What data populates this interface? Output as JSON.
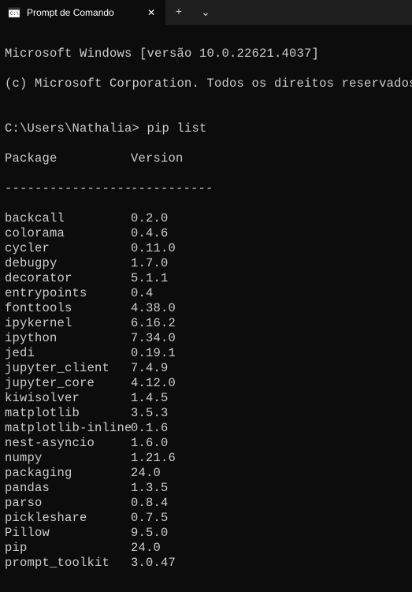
{
  "titlebar": {
    "tab_title": "Prompt de Comando",
    "close_glyph": "✕",
    "new_tab_glyph": "+",
    "dropdown_glyph": "⌄"
  },
  "terminal": {
    "line1": "Microsoft Windows [versão 10.0.22621.4037]",
    "line2": "(c) Microsoft Corporation. Todos os direitos reservados.",
    "blank": "",
    "prompt": "C:\\Users\\Nathalia> ",
    "command": "pip list",
    "header_pkg": "Package",
    "header_ver": "Version",
    "divider_pkg": "-----------------",
    "divider_ver": "-----------",
    "packages": [
      {
        "name": "backcall",
        "version": "0.2.0"
      },
      {
        "name": "colorama",
        "version": "0.4.6"
      },
      {
        "name": "cycler",
        "version": "0.11.0"
      },
      {
        "name": "debugpy",
        "version": "1.7.0"
      },
      {
        "name": "decorator",
        "version": "5.1.1"
      },
      {
        "name": "entrypoints",
        "version": "0.4"
      },
      {
        "name": "fonttools",
        "version": "4.38.0"
      },
      {
        "name": "ipykernel",
        "version": "6.16.2"
      },
      {
        "name": "ipython",
        "version": "7.34.0"
      },
      {
        "name": "jedi",
        "version": "0.19.1"
      },
      {
        "name": "jupyter_client",
        "version": "7.4.9"
      },
      {
        "name": "jupyter_core",
        "version": "4.12.0"
      },
      {
        "name": "kiwisolver",
        "version": "1.4.5"
      },
      {
        "name": "matplotlib",
        "version": "3.5.3"
      },
      {
        "name": "matplotlib-inline",
        "version": "0.1.6"
      },
      {
        "name": "nest-asyncio",
        "version": "1.6.0"
      },
      {
        "name": "numpy",
        "version": "1.21.6"
      },
      {
        "name": "packaging",
        "version": "24.0"
      },
      {
        "name": "pandas",
        "version": "1.3.5"
      },
      {
        "name": "parso",
        "version": "0.8.4"
      },
      {
        "name": "pickleshare",
        "version": "0.7.5"
      },
      {
        "name": "Pillow",
        "version": "9.5.0"
      },
      {
        "name": "pip",
        "version": "24.0"
      },
      {
        "name": "prompt_toolkit",
        "version": "3.0.47"
      }
    ]
  }
}
